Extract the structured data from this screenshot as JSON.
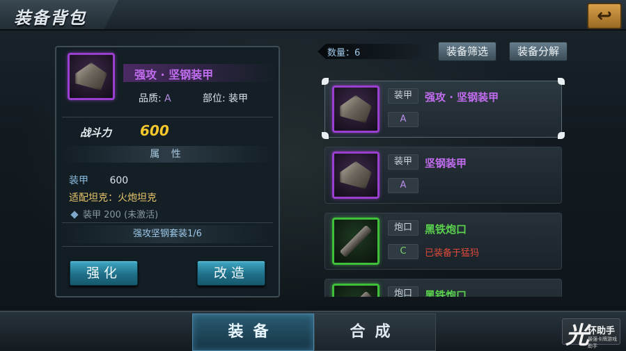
{
  "header": {
    "title": "装备背包",
    "back_icon": "return-arrow-icon",
    "back_glyph": "↩"
  },
  "detail": {
    "name": "强攻 · 坚钢装甲",
    "quality_label": "品质:",
    "quality_value": "A",
    "part_label": "部位:",
    "part_value": "装甲",
    "power_label": "战斗力",
    "power_value": "600",
    "attr_header": "属 性",
    "attr_key": "装甲",
    "attr_value": "600",
    "tank_fit": "适配坦克：火炮坦克",
    "inactive_attr": "装甲 200 (未激活)",
    "set_bonus": "强攻坚钢套装1/6",
    "strengthen_label": "强化",
    "modify_label": "改造"
  },
  "toolbar": {
    "quantity": "数量：6",
    "filter_label": "装备筛选",
    "decompose_label": "装备分解"
  },
  "list": [
    {
      "type": "装甲",
      "quality": "A",
      "name": "强攻 · 坚钢装甲",
      "status": "",
      "icon": "armor-icon",
      "rarity": "purple"
    },
    {
      "type": "装甲",
      "quality": "A",
      "name": "坚钢装甲",
      "status": "",
      "icon": "armor-icon",
      "rarity": "purple"
    },
    {
      "type": "炮口",
      "quality": "C",
      "name": "黑铁炮口",
      "status": "已装备于猛犸",
      "icon": "cannon-icon",
      "rarity": "green"
    },
    {
      "type": "炮口",
      "quality": "",
      "name": "黑铁炮口",
      "status": "",
      "icon": "cannon-icon",
      "rarity": "green"
    }
  ],
  "tabs": [
    {
      "label": "装备",
      "active": true
    },
    {
      "label": "合成",
      "active": false
    }
  ],
  "watermark": {
    "big": "光",
    "small": "环助手",
    "tiny": "最强卡牌游戏助手"
  },
  "colors": {
    "purple_rarity": "#c26df0",
    "green_rarity": "#5ad24e",
    "power": "#f6c82c",
    "equipped_warning": "#e04a3c"
  }
}
